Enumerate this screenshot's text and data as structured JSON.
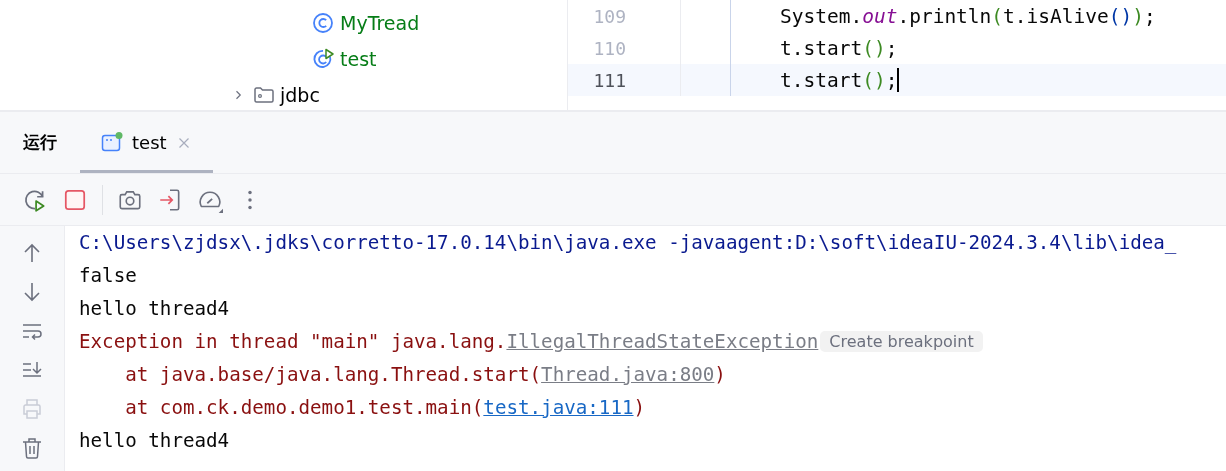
{
  "project_tree": [
    {
      "children": [
        {
          "label": "MyTread",
          "kind": "class"
        },
        {
          "label": "test",
          "kind": "runnable_class"
        }
      ]
    },
    {
      "label": "jdbc",
      "kind": "folder",
      "expanded": false
    }
  ],
  "editor": {
    "lines": [
      {
        "number": "109",
        "current": false,
        "tokens": [
          {
            "kind": "text",
            "text": "System."
          },
          {
            "kind": "field",
            "text": "out"
          },
          {
            "kind": "text",
            "text": ".println"
          },
          {
            "kind": "paren1",
            "text": "("
          },
          {
            "kind": "text",
            "text": "t.isAlive"
          },
          {
            "kind": "paren2",
            "text": "()"
          },
          {
            "kind": "paren1",
            "text": ")"
          },
          {
            "kind": "text",
            "text": ";"
          }
        ]
      },
      {
        "number": "110",
        "current": false,
        "tokens": [
          {
            "kind": "text",
            "text": "t.start"
          },
          {
            "kind": "paren1",
            "text": "()"
          },
          {
            "kind": "text",
            "text": ";"
          }
        ]
      },
      {
        "number": "111",
        "current": true,
        "tokens": [
          {
            "kind": "text",
            "text": "t.start"
          },
          {
            "kind": "paren1",
            "text": "()"
          },
          {
            "kind": "text",
            "text": ";"
          }
        ]
      }
    ]
  },
  "run_panel": {
    "title": "运行",
    "tabs": [
      {
        "label": "test",
        "selected": true,
        "running": true
      }
    ],
    "toolbar": [
      {
        "kind": "rerun"
      },
      {
        "kind": "stop"
      },
      {
        "kind": "separator"
      },
      {
        "kind": "camera"
      },
      {
        "kind": "exit"
      },
      {
        "kind": "gauge"
      },
      {
        "kind": "more"
      }
    ],
    "side_buttons": [
      {
        "kind": "up",
        "disabled": false
      },
      {
        "kind": "down",
        "disabled": false
      },
      {
        "kind": "wrap",
        "disabled": false
      },
      {
        "kind": "scroll_end",
        "disabled": false
      },
      {
        "kind": "print",
        "disabled": true
      },
      {
        "kind": "trash",
        "disabled": false
      }
    ],
    "console": [
      [
        {
          "kind": "command",
          "text": "C:\\Users\\zjdsx\\.jdks\\corretto-17.0.14\\bin\\java.exe -javaagent:D:\\soft\\ideaIU-2024.3.4\\lib\\idea_"
        }
      ],
      [
        {
          "kind": "output",
          "text": "false"
        }
      ],
      [
        {
          "kind": "output",
          "text": "hello thread4"
        }
      ],
      [
        {
          "kind": "error",
          "text": "Exception in thread \"main\" java.lang."
        },
        {
          "kind": "class_link",
          "text": "IllegalThreadStateException"
        },
        {
          "kind": "chip",
          "text": "Create breakpoint"
        }
      ],
      [
        {
          "kind": "error",
          "text": "    at java.base/java.lang.Thread.start("
        },
        {
          "kind": "class_link",
          "text": "Thread.java:800"
        },
        {
          "kind": "error",
          "text": ")"
        }
      ],
      [
        {
          "kind": "error",
          "text": "    at com.ck.demo.demo1.test.main("
        },
        {
          "kind": "file_link",
          "text": "test.java:111"
        },
        {
          "kind": "error",
          "text": ")"
        }
      ],
      [
        {
          "kind": "output",
          "text": "hello thread4"
        }
      ]
    ]
  }
}
